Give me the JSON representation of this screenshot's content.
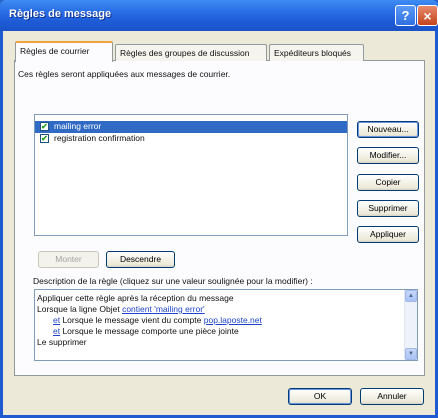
{
  "window": {
    "title": "Règles de message",
    "help_label": "?",
    "close_label": "×"
  },
  "tabs": [
    {
      "label": "Règles de courrier",
      "active": true
    },
    {
      "label": "Règles des groupes de discussion",
      "active": false
    },
    {
      "label": "Expéditeurs bloqués",
      "active": false
    }
  ],
  "intro_text": "Ces règles seront appliquées aux messages de courrier.",
  "rules": [
    {
      "label": "mailing error",
      "checked": true,
      "selected": true
    },
    {
      "label": "registration confirmation",
      "checked": true,
      "selected": false
    }
  ],
  "side_buttons": {
    "new": "Nouveau...",
    "modify": "Modifier...",
    "copy": "Copier",
    "delete": "Supprimer",
    "apply": "Appliquer"
  },
  "order_buttons": {
    "up": "Monter",
    "down": "Descendre"
  },
  "description": {
    "label": "Description de la règle (cliquez sur une valeur soulignée pour la modifier) :",
    "line1": "Appliquer cette règle après la réception du message",
    "line2_prefix": "Lorsque la ligne Objet ",
    "line2_link": "contient 'mailing error'",
    "line3_link": "et",
    "line3_text": " Lorsque le message vient du compte ",
    "line3_account": "pop.laposte.net",
    "line4_link": "et",
    "line4_text": " Lorsque le message comporte une pièce jointe",
    "line5": "Le supprimer"
  },
  "footer": {
    "ok": "OK",
    "cancel": "Annuler"
  },
  "icons": {
    "check": "✔",
    "scroll_up": "▲",
    "scroll_down": "▼"
  }
}
